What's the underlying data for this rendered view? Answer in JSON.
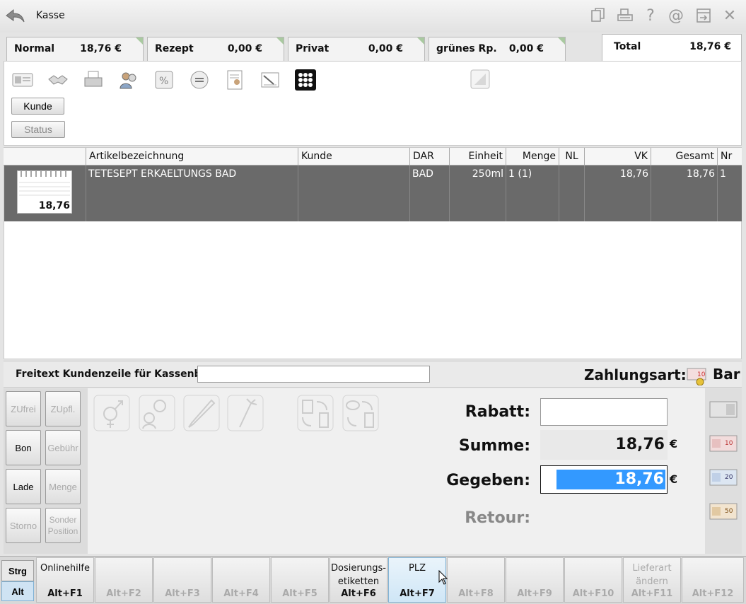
{
  "window": {
    "title": "Kasse"
  },
  "top_icons": [
    "document-copy-icon",
    "printer-icon",
    "help-icon",
    "at-icon",
    "window-exit-icon",
    "close-icon"
  ],
  "top_glyphs": {
    "help": "?",
    "at": "@",
    "close": "✕"
  },
  "tabs": [
    {
      "label": "Normal",
      "value": "18,76 €"
    },
    {
      "label": "Rezept",
      "value": "0,00 €"
    },
    {
      "label": "Privat",
      "value": "0,00 €"
    },
    {
      "label": "grünes Rp.",
      "value": "0,00 €"
    }
  ],
  "total_tab": {
    "label": "Total",
    "value": "18,76 €"
  },
  "customer_panel": {
    "kunde_button": "Kunde",
    "status_button": "Status"
  },
  "table": {
    "columns": [
      "Artikelbezeichnung",
      "Kunde",
      "DAR",
      "Einheit",
      "Menge",
      "NL",
      "VK",
      "Gesamt",
      "Nr"
    ],
    "rows": [
      {
        "price_tag": "18,76",
        "artikel": "TETESEPT ERKAELTUNGS BAD",
        "kunde": "",
        "dar": "BAD",
        "einheit": "250ml",
        "menge": "1 (1)",
        "nl": "",
        "vk": "18,76",
        "gesamt": "18,76",
        "nr": "1"
      }
    ]
  },
  "freetext": {
    "label": "Freitext Kundenzeile für Kassenbon:",
    "value": ""
  },
  "payment_type": {
    "label": "Zahlungsart:",
    "value": "Bar"
  },
  "side_buttons": [
    {
      "label": "ZUfrei",
      "enabled": false
    },
    {
      "label": "ZUpfl.",
      "enabled": false
    },
    {
      "label": "Bon",
      "enabled": true
    },
    {
      "label": "Gebühr",
      "enabled": false
    },
    {
      "label": "Lade",
      "enabled": true
    },
    {
      "label": "Menge",
      "enabled": false
    },
    {
      "label": "Storno",
      "enabled": false
    },
    {
      "label": "Sonder Position",
      "enabled": false
    }
  ],
  "payment": {
    "rabatt_label": "Rabatt:",
    "rabatt_value": "",
    "summe_label": "Summe:",
    "summe_value": "18,76",
    "gegeben_label": "Gegeben:",
    "gegeben_value": "18,76",
    "retour_label": "Retour:",
    "currency": "€"
  },
  "money_icons": [
    "euro-5-note-icon",
    "euro-10-note-icon",
    "euro-20-note-icon",
    "euro-50-note-icon"
  ],
  "modifiers": {
    "strg": "Strg",
    "alt": "Alt"
  },
  "function_keys": [
    {
      "label": "Onlinehilfe",
      "key": "Alt+F1",
      "enabled": true
    },
    {
      "label": "",
      "key": "Alt+F2",
      "enabled": false
    },
    {
      "label": "",
      "key": "Alt+F3",
      "enabled": false
    },
    {
      "label": "",
      "key": "Alt+F4",
      "enabled": false
    },
    {
      "label": "",
      "key": "Alt+F5",
      "enabled": false
    },
    {
      "label": "Dosierungs-\netiketten",
      "key": "Alt+F6",
      "enabled": true
    },
    {
      "label": "PLZ",
      "key": "Alt+F7",
      "enabled": true
    },
    {
      "label": "",
      "key": "Alt+F8",
      "enabled": false
    },
    {
      "label": "",
      "key": "Alt+F9",
      "enabled": false
    },
    {
      "label": "",
      "key": "Alt+F10",
      "enabled": false
    },
    {
      "label": "Lieferart\nändern",
      "key": "Alt+F11",
      "enabled": false
    },
    {
      "label": "",
      "key": "Alt+F12",
      "enabled": false
    }
  ]
}
